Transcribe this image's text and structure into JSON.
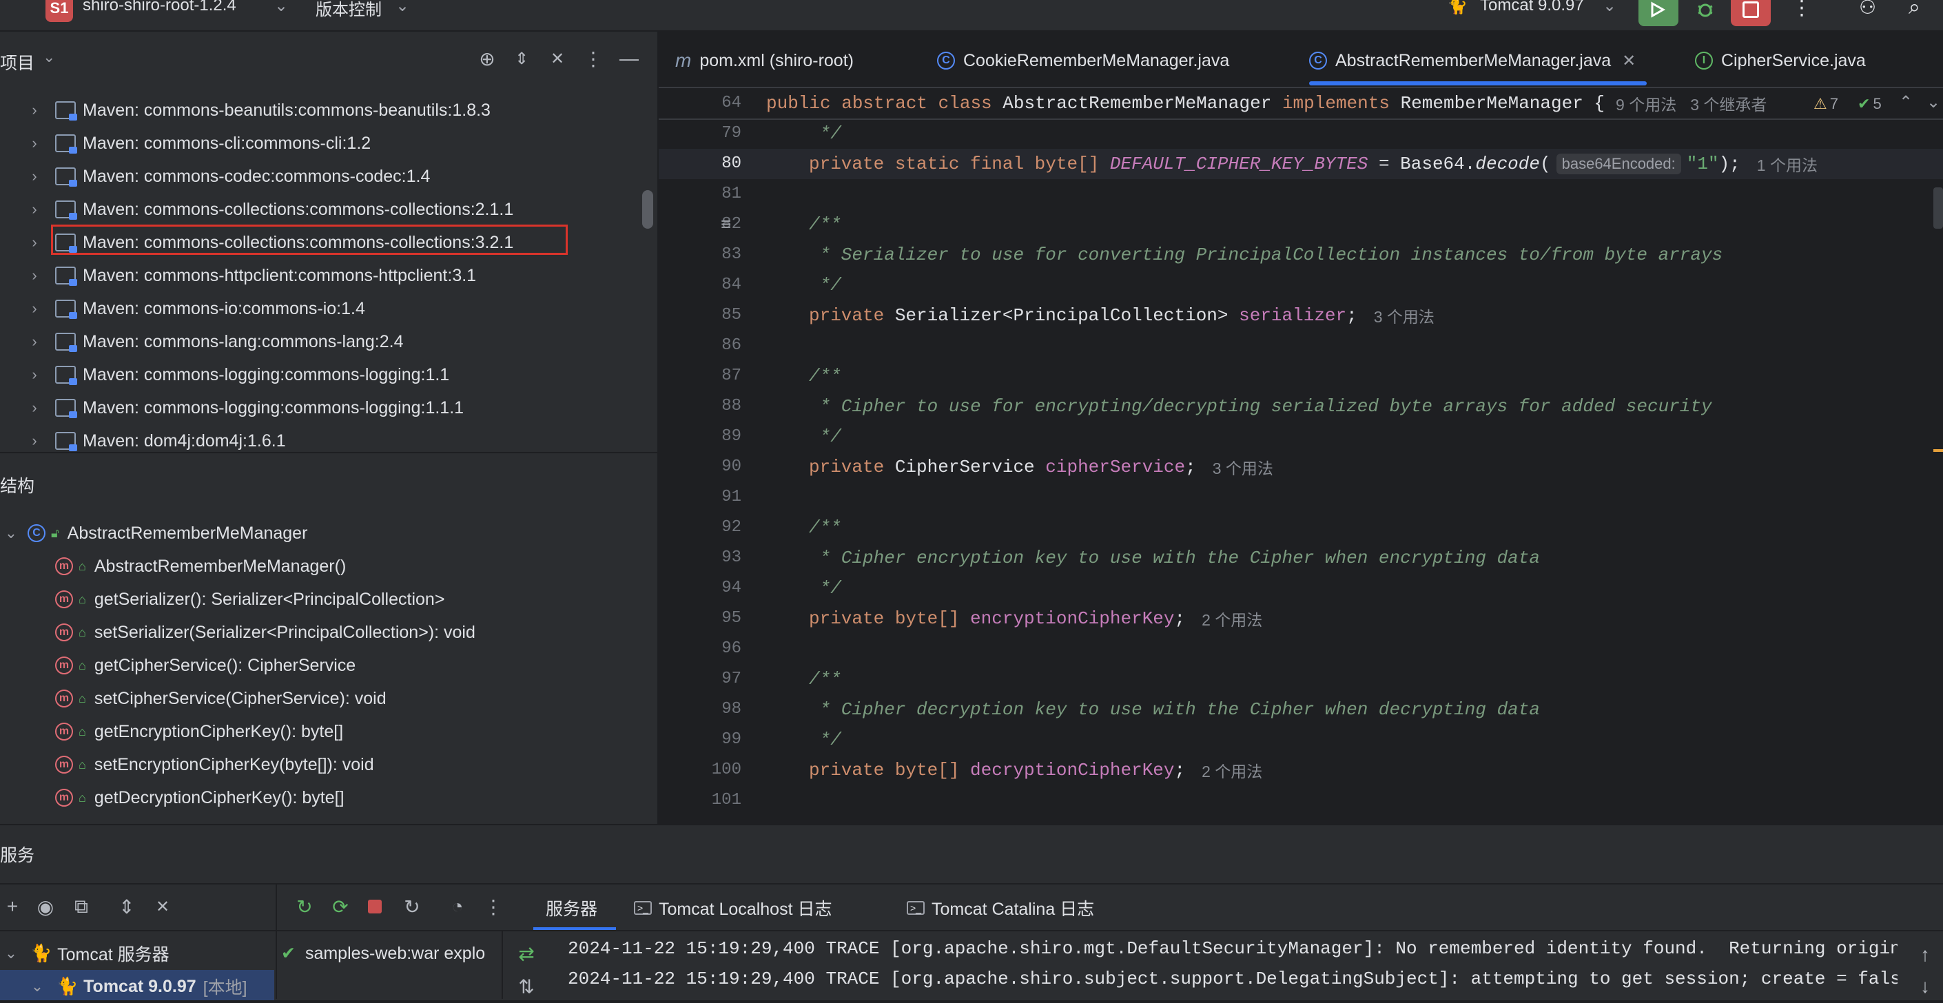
{
  "topbar": {
    "project_badge": "S1",
    "project_name": "shiro-shiro-root-1.2.4",
    "vcs_label": "版本控制",
    "run_config": "Tomcat 9.0.97"
  },
  "project_panel": {
    "title": "项目",
    "items": [
      {
        "label": "Maven: commons-beanutils:commons-beanutils:1.8.3"
      },
      {
        "label": "Maven: commons-cli:commons-cli:1.2"
      },
      {
        "label": "Maven: commons-codec:commons-codec:1.4"
      },
      {
        "label": "Maven: commons-collections:commons-collections:2.1.1"
      },
      {
        "label": "Maven: commons-collections:commons-collections:3.2.1",
        "highlighted": true
      },
      {
        "label": "Maven: commons-httpclient:commons-httpclient:3.1"
      },
      {
        "label": "Maven: commons-io:commons-io:1.4"
      },
      {
        "label": "Maven: commons-lang:commons-lang:2.4"
      },
      {
        "label": "Maven: commons-logging:commons-logging:1.1"
      },
      {
        "label": "Maven: commons-logging:commons-logging:1.1.1"
      },
      {
        "label": "Maven: dom4j:dom4j:1.6.1"
      }
    ],
    "highlight_color": "#d9342b"
  },
  "structure_panel": {
    "title": "结构",
    "root": "AbstractRememberMeManager",
    "members": [
      "AbstractRememberMeManager()",
      "getSerializer(): Serializer<PrincipalCollection>",
      "setSerializer(Serializer<PrincipalCollection>): void",
      "getCipherService(): CipherService",
      "setCipherService(CipherService): void",
      "getEncryptionCipherKey(): byte[]",
      "setEncryptionCipherKey(byte[]): void",
      "getDecryptionCipherKey(): byte[]"
    ]
  },
  "editor": {
    "tabs": [
      {
        "label": "pom.xml (shiro-root)",
        "icon": "maven-icon"
      },
      {
        "label": "CookieRememberMeManager.java",
        "icon": "class-icon"
      },
      {
        "label": "AbstractRememberMeManager.java",
        "icon": "class-icon",
        "active": true
      },
      {
        "label": "CipherService.java",
        "icon": "interface-icon"
      }
    ],
    "sticky": {
      "line": "64",
      "kw1": "public abstract class ",
      "name": "AbstractRememberMeManager ",
      "kw2": "implements ",
      "iface": "RememberMeManager {",
      "usages": "9 个用法",
      "inheritors": "3 个继承者",
      "warnings": "7",
      "checks": "5"
    },
    "lines": {
      "l79": {
        "num": "79",
        "text": " */"
      },
      "l80": {
        "num": "80",
        "kw": "private static final ",
        "type": "byte[] ",
        "const": "DEFAULT_CIPHER_KEY_BYTES",
        "eq": " = Base64.",
        "fn": "decode",
        "paren": "(",
        "inlay": "base64Encoded:",
        "str": "\"1\"",
        "end": ");",
        "hint": "1 个用法"
      },
      "l81": {
        "num": "81"
      },
      "l82": {
        "num": "82",
        "text": "/**"
      },
      "l83": {
        "num": "83",
        "text": " * Serializer to use for converting PrincipalCollection instances to/from byte arrays"
      },
      "l84": {
        "num": "84",
        "text": " */"
      },
      "l85": {
        "num": "85",
        "kw": "private ",
        "type": "Serializer<PrincipalCollection> ",
        "field": "serializer",
        "end": ";",
        "hint": "3 个用法"
      },
      "l86": {
        "num": "86"
      },
      "l87": {
        "num": "87",
        "text": "/**"
      },
      "l88": {
        "num": "88",
        "text": " * Cipher to use for encrypting/decrypting serialized byte arrays for added security"
      },
      "l89": {
        "num": "89",
        "text": " */"
      },
      "l90": {
        "num": "90",
        "kw": "private ",
        "type": "CipherService ",
        "field": "cipherService",
        "end": ";",
        "hint": "3 个用法"
      },
      "l91": {
        "num": "91"
      },
      "l92": {
        "num": "92",
        "text": "/**"
      },
      "l93": {
        "num": "93",
        "text": " * Cipher encryption key to use with the Cipher when encrypting data"
      },
      "l94": {
        "num": "94",
        "text": " */"
      },
      "l95": {
        "num": "95",
        "kw": "private ",
        "type": "byte[] ",
        "field": "encryptionCipherKey",
        "end": ";",
        "hint": "2 个用法"
      },
      "l96": {
        "num": "96"
      },
      "l97": {
        "num": "97",
        "text": "/**"
      },
      "l98": {
        "num": "98",
        "text": " * Cipher decryption key to use with the Cipher when decrypting data"
      },
      "l99": {
        "num": "99",
        "text": " */"
      },
      "l100": {
        "num": "100",
        "kw": "private ",
        "type": "byte[] ",
        "field": "decryptionCipherKey",
        "end": ";",
        "hint": "2 个用法"
      },
      "l101": {
        "num": "101"
      }
    }
  },
  "services": {
    "title": "服务",
    "tabs": [
      "服务器",
      "Tomcat Localhost 日志",
      "Tomcat Catalina 日志"
    ],
    "tree": {
      "server": "Tomcat 服务器",
      "instance": "Tomcat 9.0.97",
      "instance_tag": "[本地]"
    },
    "deployment": "samples-web:war explo",
    "log": [
      "2024-11-22 15:19:29,400 TRACE [org.apache.shiro.mgt.DefaultSecurityManager]: No remembered identity found.  Returning origin",
      "2024-11-22 15:19:29,400 TRACE [org.apache.shiro.subject.support.DelegatingSubject]: attempting to get session; create = fals"
    ]
  }
}
